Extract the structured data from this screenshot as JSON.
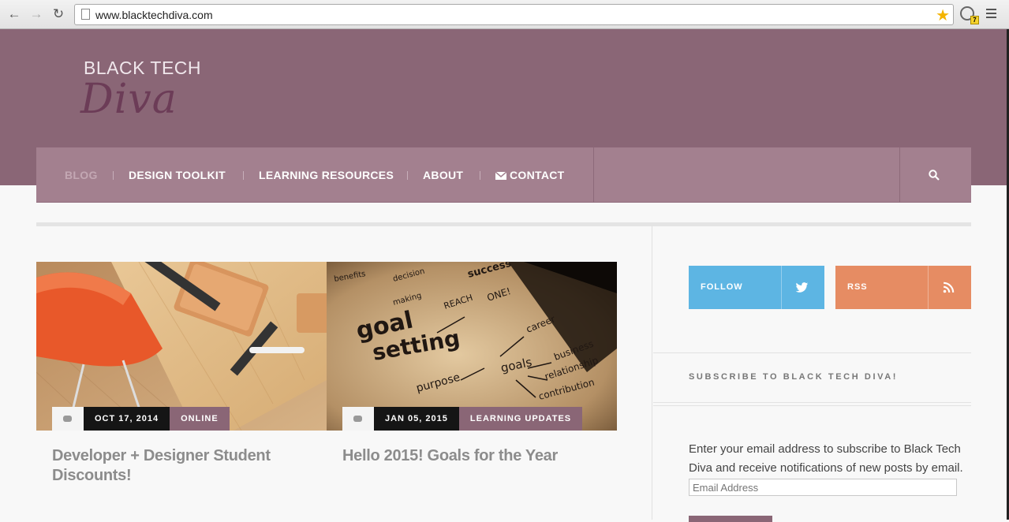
{
  "browser": {
    "url": "www.blacktechdiva.com",
    "back_icon": "back-arrow-icon",
    "forward_icon": "forward-arrow-icon",
    "reload_icon": "reload-icon",
    "bookmark_icon": "star-icon",
    "extension_badge": "7"
  },
  "site": {
    "logo_top": "BLACK TECH",
    "logo_script": "Diva",
    "colors": {
      "header": "#8a6676",
      "nav": "#a3808f",
      "twitter": "#5db5e3",
      "rss": "#e68c63",
      "logo_script": "#6c3c57"
    }
  },
  "nav": {
    "items": [
      {
        "label": "BLOG",
        "active": true
      },
      {
        "label": "DESIGN TOOLKIT"
      },
      {
        "label": "LEARNING RESOURCES"
      },
      {
        "label": "ABOUT"
      },
      {
        "label": "CONTACT",
        "icon": "mail-icon"
      }
    ],
    "search_icon": "search-icon"
  },
  "posts": [
    {
      "date": "OCT 17, 2014",
      "category": "ONLINE",
      "title": "Developer + Designer Student Discounts!"
    },
    {
      "date": "JAN 05, 2015",
      "category": "LEARNING UPDATES",
      "title": "Hello 2015! Goals for the Year",
      "image_words": [
        "goal",
        "setting",
        "purpose",
        "goals",
        "REACH",
        "ONE!",
        "career",
        "business",
        "relationship",
        "contribution",
        "benefits",
        "decision",
        "making",
        "success"
      ]
    }
  ],
  "sidebar": {
    "follow_label": "FOLLOW",
    "rss_label": "RSS",
    "subscribe_heading": "SUBSCRIBE TO BLACK TECH DIVA!",
    "subscribe_text": "Enter your email address to subscribe to Black Tech Diva and receive notifications of new posts by email.",
    "email_placeholder": "Email Address"
  }
}
